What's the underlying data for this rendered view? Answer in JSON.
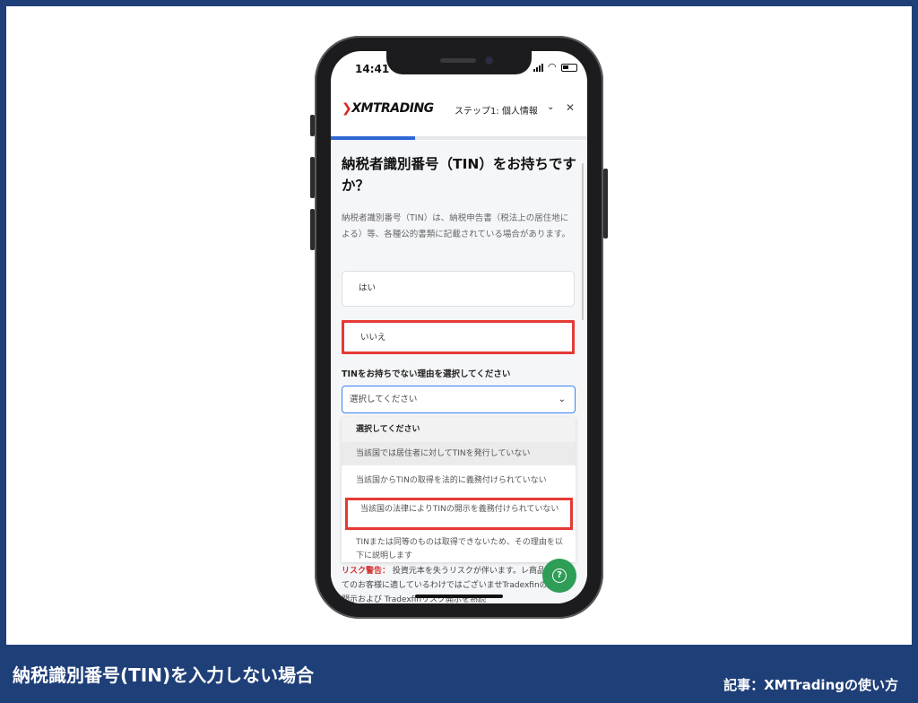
{
  "status_bar": {
    "time": "14:41"
  },
  "app_header": {
    "logo": "XMTRADING",
    "step": "ステップ1: 個人情報",
    "progress": 0.33
  },
  "question": {
    "title": "納税者識別番号（TIN）をお持ちですか？",
    "description": "納税者識別番号（TIN）は、納税申告書（税法上の居住地による）等、各種公的書類に記載されている場合があります。"
  },
  "options": {
    "yes": "はい",
    "no": "いいえ"
  },
  "reason_select": {
    "label": "TINをお持ちでない理由を選択してください",
    "placeholder": "選択してください",
    "items": [
      "選択してください",
      "当該国では居住者に対してTINを発行していない",
      "当該国からTINの取得を法的に義務付けられていない",
      "当該国の法律によりTINの開示を義務付けられていない",
      "TINまたは同等のものは取得できないため、その理由を以下に説明します"
    ]
  },
  "risk_warning": {
    "label": "リスク警告：",
    "text": "投資元本を失うリスクが伴います。レ商品は、全てのお客様に適しているわけではございませTradexfinのリスク開示および Tradexfinリスク開示を熟読"
  },
  "footer": {
    "title": "納税識別番号(TIN)を入力しない場合",
    "credit": "記事：XMTradingの使い方"
  },
  "colors": {
    "frame": "#1f3f78",
    "highlight": "#e53935",
    "accent": "#2f66d6",
    "fab": "#2e9e57"
  }
}
